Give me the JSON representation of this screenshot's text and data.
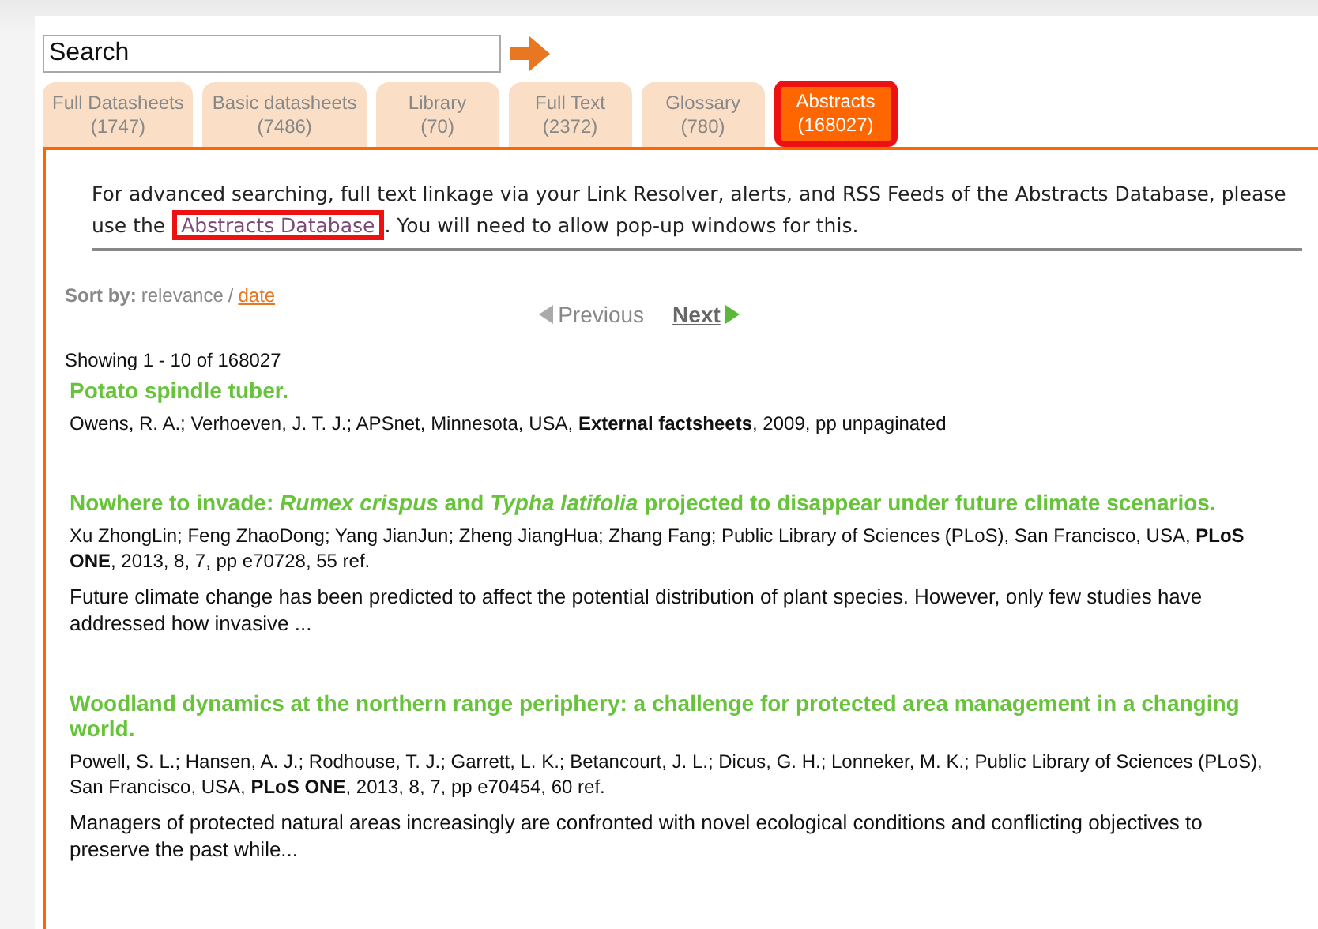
{
  "search": {
    "placeholder": "Search"
  },
  "tabs": [
    {
      "label": "Full Datasheets",
      "count": "(1747)",
      "selected": false,
      "highlighted": false
    },
    {
      "label": "Basic datasheets",
      "count": "(7486)",
      "selected": false,
      "highlighted": false
    },
    {
      "label": "Library",
      "count": "(70)",
      "selected": false,
      "highlighted": false
    },
    {
      "label": "Full Text",
      "count": "(2372)",
      "selected": false,
      "highlighted": false
    },
    {
      "label": "Glossary",
      "count": "(780)",
      "selected": false,
      "highlighted": false
    },
    {
      "label": "Abstracts",
      "count": "(168027)",
      "selected": true,
      "highlighted": true
    }
  ],
  "notice": {
    "text_before": "For advanced searching, full text linkage via your Link Resolver, alerts, and RSS Feeds of the Abstracts Database, please use the ",
    "link": "Abstracts Database",
    "link_highlighted": true,
    "text_after": ". You will need to allow pop-up windows for this."
  },
  "sort": {
    "label": "Sort by:",
    "separator": "/",
    "options": [
      {
        "label": "relevance",
        "selected": true
      },
      {
        "label": "date",
        "selected": false
      }
    ]
  },
  "pager": {
    "previous": {
      "label": "Previous",
      "disabled": true
    },
    "next": {
      "label": "Next",
      "disabled": false
    }
  },
  "showing": "Showing 1 - 10 of 168027",
  "results": [
    {
      "title": "Potato spindle tuber.",
      "meta": "Owens, R. A.;  Verhoeven, J. T. J.;  APSnet, Minnesota, USA,  **External factsheets**, 2009, pp unpaginated"
    },
    {
      "title": "Nowhere to invade: *Rumex crispus* and *Typha latifolia* projected to disappear under future climate scenarios.",
      "meta": "Xu ZhongLin;  Feng ZhaoDong;  Yang JianJun;  Zheng JiangHua;  Zhang Fang;  Public Library of Sciences (PLoS), San Francisco, USA,  **PLoS ONE**, 2013, 8, 7, pp e70728, 55 ref.",
      "abstract": "Future climate change has been predicted to affect the potential distribution of plant species. However, only few studies have addressed how invasive ..."
    },
    {
      "title": "Woodland dynamics at the northern range periphery: a challenge for protected area management in a changing world.",
      "meta": "Powell, S. L.;  Hansen, A. J.;  Rodhouse, T. J.;  Garrett, L. K.;  Betancourt, J. L.;  Dicus, G. H.;  Lonneker, M. K.;  Public Library of Sciences (PLoS), San Francisco, USA,  **PLoS ONE**, 2013, 8, 7, pp e70454, 60 ref.",
      "abstract": "Managers of protected natural areas increasingly are confronted with novel ecological conditions and conflicting objectives to preserve the past while..."
    }
  ]
}
